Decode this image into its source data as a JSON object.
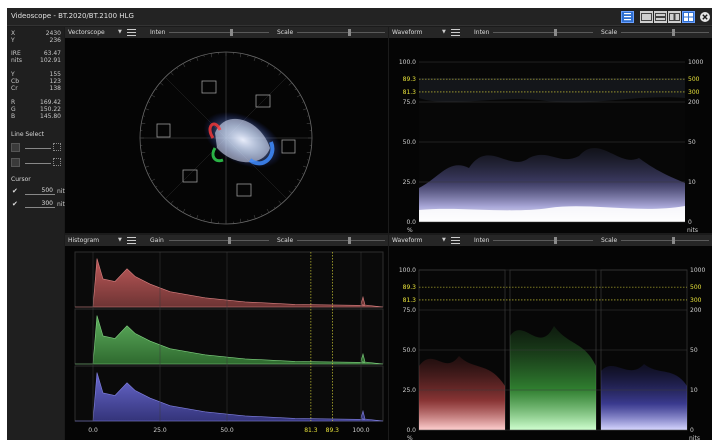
{
  "window": {
    "title": "Videoscope - BT.2020/BT.2100 HLG",
    "close_icon": "close-icon"
  },
  "readouts": {
    "x": {
      "label": "X",
      "value": "2430"
    },
    "y": {
      "label": "Y",
      "value": "236"
    },
    "ire": {
      "label": "IRE",
      "value": "63.47"
    },
    "nits": {
      "label": "nits",
      "value": "102.91"
    },
    "luma": {
      "label": "Y",
      "value": "155"
    },
    "cb": {
      "label": "Cb",
      "value": "123"
    },
    "cr": {
      "label": "Cr",
      "value": "138"
    },
    "r": {
      "label": "R",
      "value": "169.42"
    },
    "g": {
      "label": "G",
      "value": "150.22"
    },
    "b": {
      "label": "B",
      "value": "145.80"
    }
  },
  "line_select": {
    "label": "Line Select"
  },
  "cursor": {
    "label": "Cursor",
    "items": [
      {
        "value": "500",
        "unit": "nits",
        "checked": true
      },
      {
        "value": "300",
        "unit": "nits",
        "checked": true
      }
    ]
  },
  "vectorscope": {
    "mode": "Vectorscope",
    "inten_label": "Inten",
    "scale_label": "Scale",
    "inten_level": 0.62,
    "scale_level": 0.6
  },
  "waveform_top": {
    "mode": "Waveform",
    "inten_label": "Inten",
    "scale_label": "Scale",
    "inten_level": 0.62,
    "scale_level": 0.6,
    "left_ticks": [
      "100.0",
      "89.3",
      "81.3",
      "75.0",
      "50.0",
      "25.0",
      "0.0"
    ],
    "left_unit": "%",
    "right_ticks": [
      "1000",
      "500",
      "300",
      "200",
      "50",
      "10",
      "0"
    ],
    "right_unit": "nits"
  },
  "histogram": {
    "mode": "Histogram",
    "gain_label": "Gain",
    "scale_label": "Scale",
    "gain_level": 0.6,
    "scale_level": 0.6,
    "x_ticks": [
      "0.0",
      "25.0",
      "50.0",
      "100.0"
    ],
    "cursor_ticks": [
      "81.3",
      "89.3"
    ]
  },
  "waveform_bottom": {
    "mode": "Waveform",
    "inten_label": "Inten",
    "scale_label": "Scale",
    "inten_level": 0.62,
    "scale_level": 0.6,
    "left_ticks": [
      "100.0",
      "89.3",
      "81.3",
      "75.0",
      "50.0",
      "25.0",
      "0.0"
    ],
    "left_unit": "%",
    "right_ticks": [
      "1000",
      "500",
      "300",
      "200",
      "50",
      "10",
      "0"
    ],
    "right_unit": "nits"
  },
  "colors": {
    "cursor_yellow": "#e7e23a",
    "accent_blue": "#2f6fd0"
  }
}
